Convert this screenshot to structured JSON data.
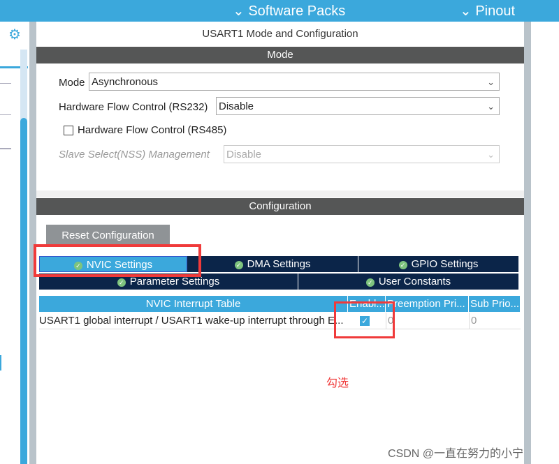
{
  "topbar": {
    "software_packs": "Software Packs",
    "pinout": "Pinout"
  },
  "panel_title": "USART1 Mode and Configuration",
  "mode_section": {
    "header": "Mode",
    "mode_label": "Mode",
    "mode_value": "Asynchronous",
    "hwfc232_label": "Hardware Flow Control (RS232)",
    "hwfc232_value": "Disable",
    "hwfc485_label": "Hardware Flow Control (RS485)",
    "hwfc485_checked": false,
    "nss_label": "Slave Select(NSS) Management",
    "nss_value": "Disable"
  },
  "config_section": {
    "header": "Configuration",
    "reset_label": "Reset Configuration",
    "tabs": [
      "NVIC Settings",
      "DMA Settings",
      "GPIO Settings",
      "Parameter Settings",
      "User Constants"
    ],
    "active_tab": "NVIC Settings"
  },
  "nvic_table": {
    "columns": [
      "NVIC Interrupt Table",
      "Enabl...",
      "Preemption Pri...",
      "Sub Prio..."
    ],
    "rows": [
      {
        "name": "USART1 global interrupt / USART1 wake-up interrupt through E...",
        "enabled": true,
        "preemption": "0",
        "sub": "0"
      }
    ]
  },
  "annotation": "勾选",
  "watermark": "CSDN @一直在努力的小宁",
  "colors": {
    "accent": "#3ba8dc",
    "tab_dark": "#0b2549",
    "section_header": "#555656",
    "highlight": "#f03a3a"
  }
}
